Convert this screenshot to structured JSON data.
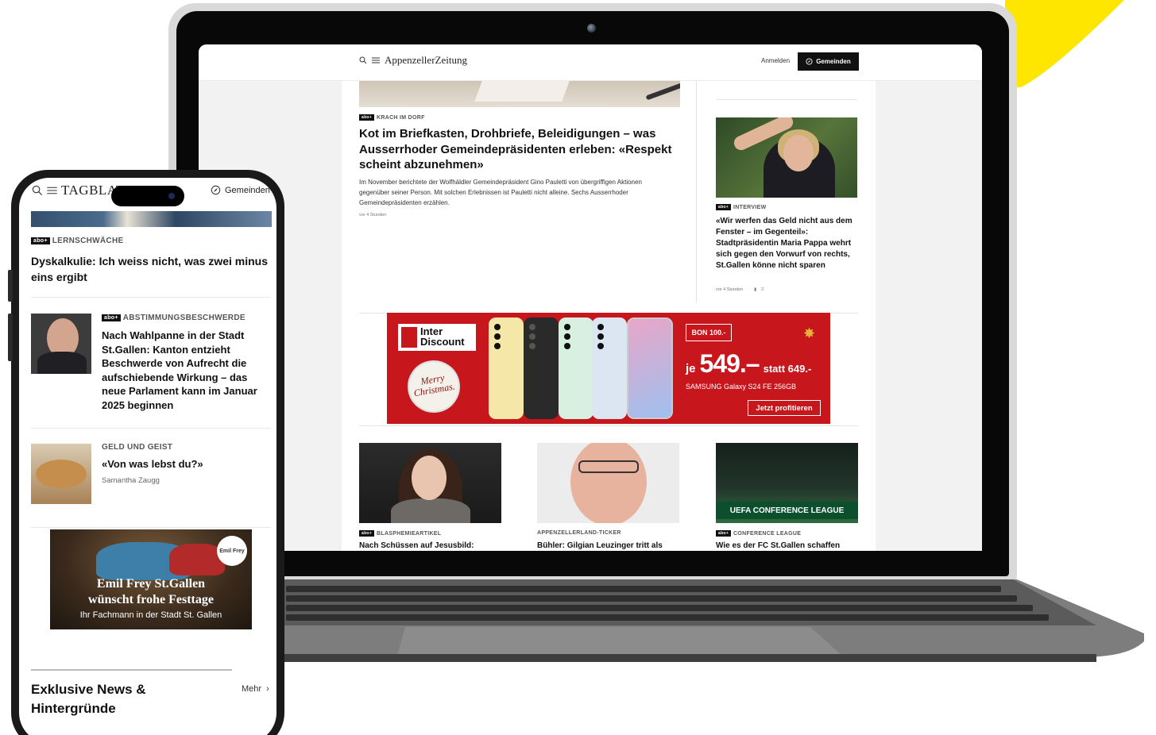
{
  "colors": {
    "accent_yellow": "#ffe600",
    "ad_red": "#c8161d",
    "dark": "#111111"
  },
  "desktop": {
    "header": {
      "icons": [
        "search-icon",
        "menu-icon"
      ],
      "brand": "AppenzellerZeitung",
      "login_label": "Anmelden",
      "gemeinden_label": "Gemeinden",
      "gemeinden_icon": "compass-icon"
    },
    "main_article": {
      "badge": "abo+",
      "kicker": "KRACH IM DORF",
      "title": "Kot im Briefkasten, Drohbriefe, Beleidigungen – was Ausserrhoder Gemeindepräsidenten erleben: «Respekt scheint abzunehmen»",
      "lead": "Im November berichtete der Wolfhäldler Gemeindepräsident Gino Pauletti von übergriffigen Aktionen gegenüber seiner Person. Mit solchen Erlebnissen ist Pauletti nicht alleine. Sechs Ausserrhoder Gemeindepräsidenten erzählen.",
      "time": "vor 4 Stunden"
    },
    "side_article": {
      "badge": "abo+",
      "kicker": "INTERVIEW",
      "title": "«Wir werfen das Geld nicht aus dem Fenster – im Gegenteil»: Stadtpräsidentin Maria Pappa wehrt sich gegen den Vorwurf von rechts, St.Gallen könne nicht sparen",
      "time": "vor 4 Stunden",
      "comments": "2"
    },
    "ad": {
      "logo_line1": "Inter",
      "logo_line2": "Discount",
      "ball_line1": "Merry",
      "ball_line2": "Christmas.",
      "bon": "BON 100.-",
      "je": "je",
      "price": "549.–",
      "statt": "statt 649.-",
      "model": "SAMSUNG Galaxy S24 FE 256GB",
      "cta": "Jetzt profitieren"
    },
    "cards": [
      {
        "badge": "abo+",
        "kicker": "BLASPHEMIEARTIKEL",
        "title": "Nach Schüssen auf Jesusbild:"
      },
      {
        "badge": "",
        "kicker": "APPENZELLERLAND-TICKER",
        "title": "Bühler: Gilgian Leuzinger tritt als"
      },
      {
        "badge": "abo+",
        "kicker": "CONFERENCE LEAGUE",
        "title": "Wie es der FC St.Gallen schaffen",
        "image_banner": "UEFA CONFERENCE LEAGUE"
      }
    ]
  },
  "phone": {
    "header": {
      "brand": "TAGBLATT",
      "gemeinden_label": "Gemeinden"
    },
    "article1": {
      "badge": "abo+",
      "kicker": "LERNSCHWÄCHE",
      "title": "Dyskalkulie: Ich weiss nicht, was zwei minus eins ergibt"
    },
    "article2": {
      "badge": "abo+",
      "kicker": "ABSTIMMUNGSBESCHWERDE",
      "title": "Nach Wahlpanne in der Stadt St.Gallen: Kanton entzieht Beschwerde von Aufrecht die aufschiebende Wirkung – das neue Parlament kann im Januar 2025 beginnen"
    },
    "article3": {
      "kicker": "GELD UND GEIST",
      "title": "«Von was lebst du?»",
      "author": "Samantha Zaugg"
    },
    "ad": {
      "badge": "Emil Frey",
      "line1": "Emil Frey St.Gallen",
      "line2": "wünscht frohe Festtage",
      "line3": "Ihr Fachmann in der Stadt St. Gallen"
    },
    "section": {
      "title": "Exklusive News & Hintergründe",
      "more_label": "Mehr"
    }
  }
}
